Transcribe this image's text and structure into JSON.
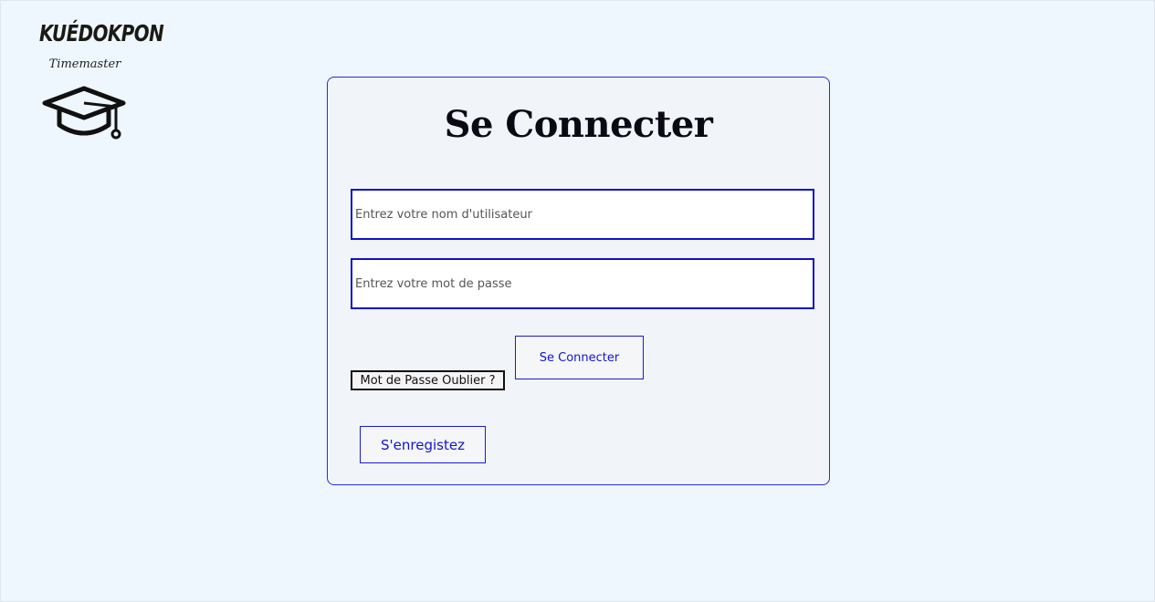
{
  "logo": {
    "brand": "KUÉDOKPON",
    "subtitle": "Timemaster",
    "icon": "graduation-cap-icon"
  },
  "login": {
    "title": "Se Connecter",
    "username_placeholder": "Entrez votre nom d'utilisateur",
    "password_placeholder": "Entrez votre mot de passe",
    "forgot_label": "Mot de Passe Oublier ?",
    "submit_label": "Se Connecter",
    "register_label": "S'enregistez"
  },
  "colors": {
    "page_background": "#eef6fe",
    "card_background": "#f1f5f9",
    "accent_blue": "#1515cc",
    "title_text": "#0a0a14"
  }
}
